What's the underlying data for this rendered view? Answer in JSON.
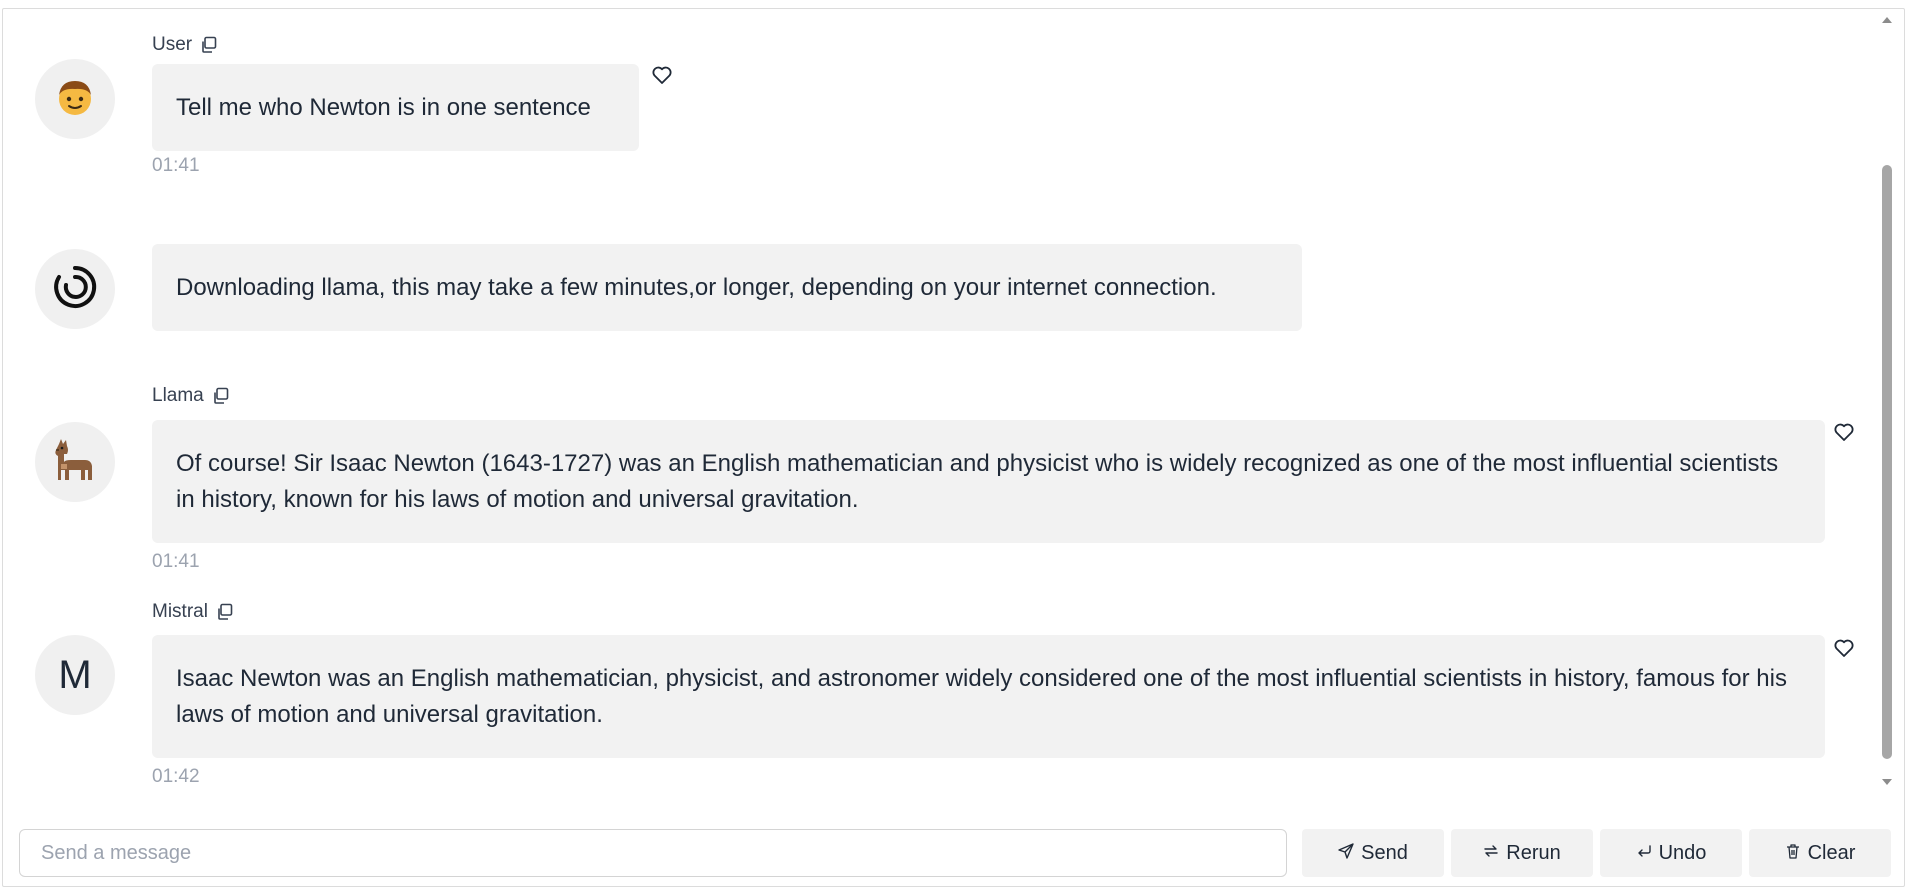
{
  "messages": [
    {
      "sender": "User",
      "avatar_icon": "boy-emoji-icon",
      "text": "Tell me who Newton is in one sentence",
      "time": "01:41",
      "liked": false
    },
    {
      "sender": "",
      "avatar_icon": "loading-spinner-icon",
      "text": "Downloading llama, this may take a few minutes,or longer, depending on your internet connection.",
      "time": ""
    },
    {
      "sender": "Llama",
      "avatar_icon": "llama-emoji-icon",
      "text": "Of course! Sir Isaac Newton (1643-1727) was an English mathematician and physicist who is widely recognized as one of the most influential scientists in history, known for his laws of motion and universal gravitation.",
      "time": "01:41",
      "liked": false
    },
    {
      "sender": "Mistral",
      "avatar_letter": "M",
      "text": "Isaac Newton was an English mathematician, physicist, and astronomer widely considered one of the most influential scientists in history, famous for his laws of motion and universal gravitation.",
      "time": "01:42",
      "liked": false
    }
  ],
  "composer": {
    "placeholder": "Send a message",
    "value": ""
  },
  "buttons": {
    "send": "Send",
    "rerun": "Rerun",
    "undo": "Undo",
    "clear": "Clear"
  },
  "colors": {
    "bubble_bg": "#f2f2f2",
    "avatar_bg": "#f0f0f0",
    "timestamp": "#9ca3af",
    "button_bg": "#f2f2f2"
  }
}
